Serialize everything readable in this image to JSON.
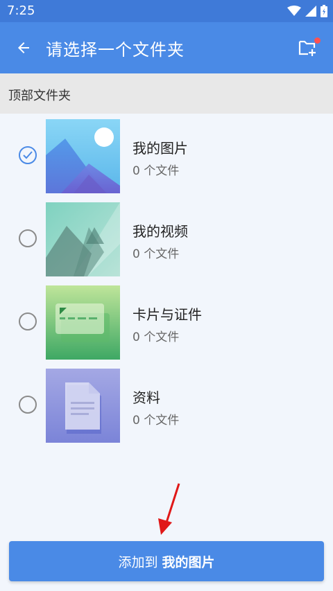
{
  "status_bar": {
    "time": "7:25"
  },
  "app_bar": {
    "title": "请选择一个文件夹"
  },
  "section": {
    "title": "顶部文件夹"
  },
  "folders": [
    {
      "name": "我的图片",
      "count": "0 个文件",
      "selected": true,
      "thumb": "pictures-thumbnail"
    },
    {
      "name": "我的视频",
      "count": "0 个文件",
      "selected": false,
      "thumb": "videos-thumbnail"
    },
    {
      "name": "卡片与证件",
      "count": "0 个文件",
      "selected": false,
      "thumb": "cards-thumbnail"
    },
    {
      "name": "资料",
      "count": "0 个文件",
      "selected": false,
      "thumb": "documents-thumbnail"
    }
  ],
  "add_button": {
    "prefix": "添加到",
    "target": "我的图片"
  },
  "colors": {
    "status_bar": "#3f7ad8",
    "app_bar": "#4a8ae6",
    "accent": "#4a8ae6",
    "background": "#f2f6fc",
    "annotation_arrow": "#e01818"
  }
}
